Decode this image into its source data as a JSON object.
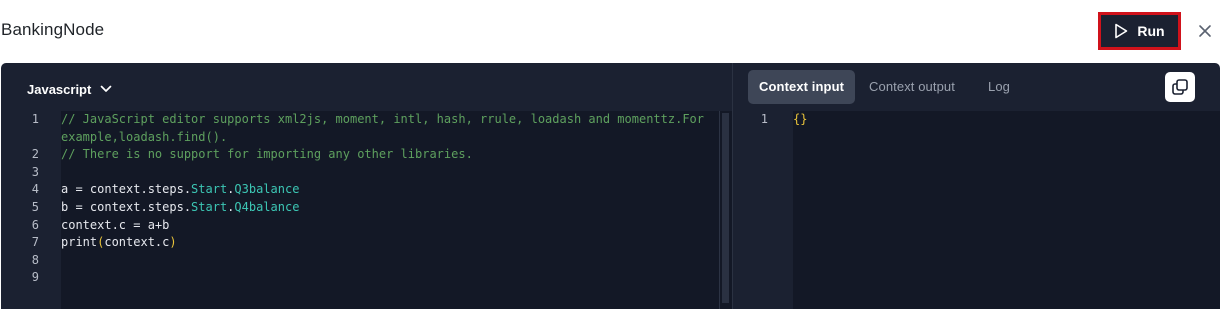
{
  "header": {
    "title": "BankingNode",
    "run_label": "Run",
    "run_icon": "play-icon",
    "close_icon": "close-icon",
    "colors": {
      "run_border": "#d0121b",
      "run_bg": "#1b2131"
    }
  },
  "editor": {
    "language": "Javascript",
    "language_icon": "chevron-down-icon",
    "line_numbers": [
      "1",
      "",
      "2",
      "3",
      "4",
      "5",
      "6",
      "7",
      "8",
      "9"
    ],
    "code_lines": [
      "// JavaScript editor supports xml2js, moment, intl, hash, rrule, loadash and momenttz.For",
      "example,loadash.find().",
      "// There is no support for importing any other libraries.",
      "",
      "a = context.steps.Start.Q3balance",
      "b = context.steps.Start.Q4balance",
      "context.c = a+b",
      "print(context.c)",
      "",
      ""
    ],
    "colors": {
      "background": "#131826",
      "comment": "#5ea05e",
      "property": "#3cc6b4",
      "paren": "#e9c33a"
    }
  },
  "context_panel": {
    "tabs": [
      {
        "label": "Context input",
        "active": true
      },
      {
        "label": "Context output",
        "active": false
      },
      {
        "label": "Log",
        "active": false
      }
    ],
    "copy_icon": "copy-icon",
    "line_numbers": [
      "1"
    ],
    "code": "{}"
  }
}
